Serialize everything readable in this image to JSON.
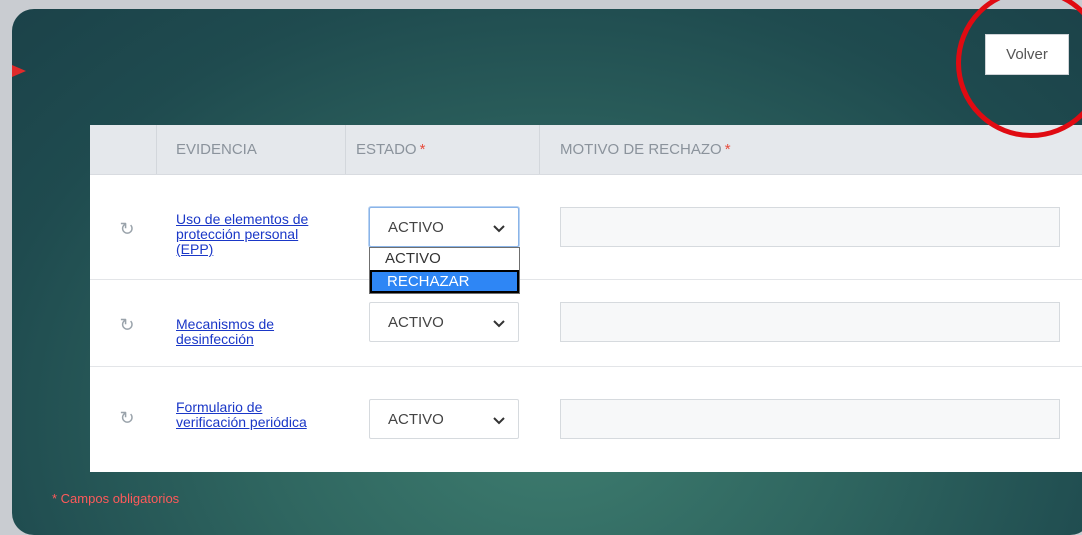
{
  "header": {
    "back_button": "Volver"
  },
  "table": {
    "columns": [
      {
        "label": "EVIDENCIA",
        "required_mark": ""
      },
      {
        "label": "ESTADO",
        "required_mark": "*"
      },
      {
        "label": "MOTIVO DE RECHAZO",
        "required_mark": "*"
      }
    ],
    "rows": [
      {
        "evidence": "Uso de elementos de protección personal (EPP)",
        "estado": "ACTIVO",
        "motivo": ""
      },
      {
        "evidence": "Mecanismos de desinfección",
        "estado": "ACTIVO",
        "motivo": ""
      },
      {
        "evidence": "Formulario de verificación periódica",
        "estado": "ACTIVO",
        "motivo": ""
      }
    ],
    "open_dropdown": {
      "options": [
        "ACTIVO",
        "RECHAZAR"
      ],
      "highlighted": "RECHAZAR"
    }
  },
  "footer": {
    "required_note": "* Campos obligatorios"
  },
  "colors": {
    "accent": "#2e86f5",
    "annotation": "#e00b12",
    "required": "#ff5a5a"
  }
}
